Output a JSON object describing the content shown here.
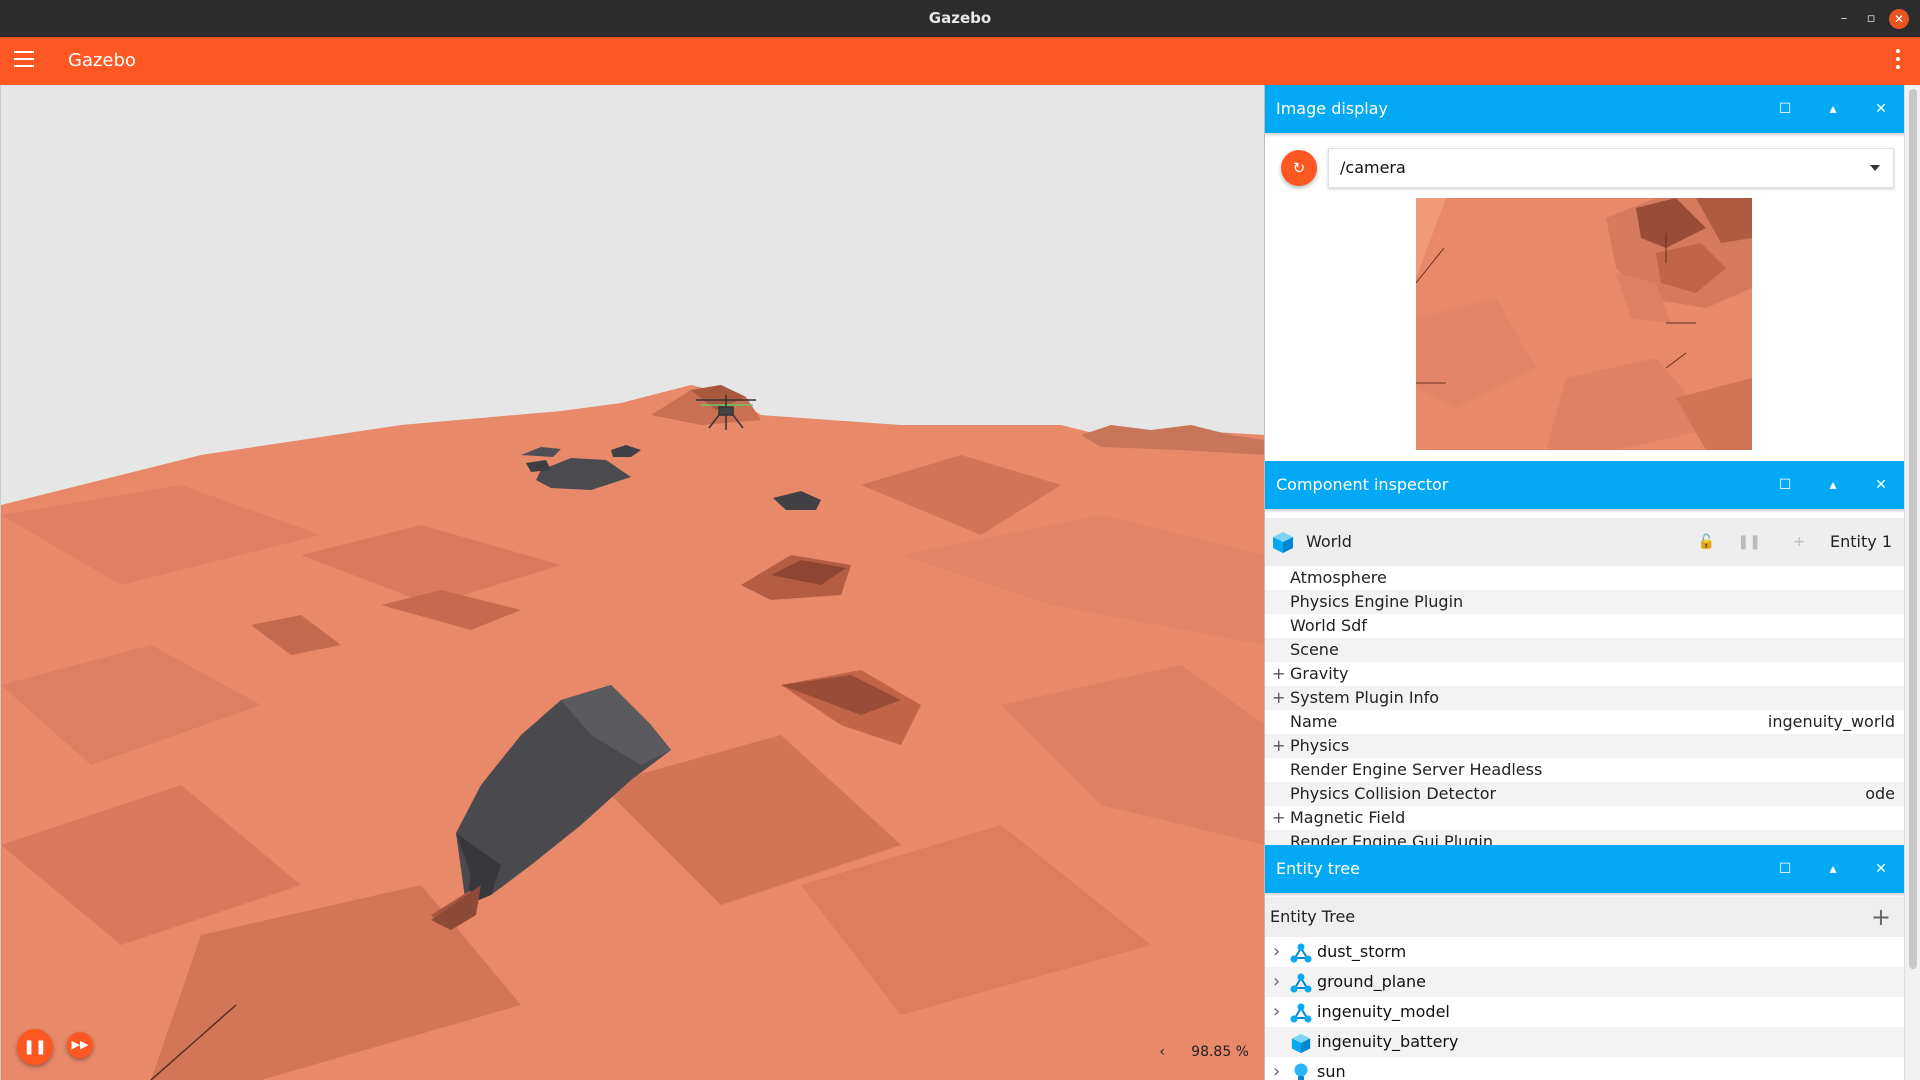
{
  "window": {
    "title": "Gazebo",
    "minimize_glyph": "–",
    "maximize_glyph": "▫",
    "close_glyph": "✕"
  },
  "appbar": {
    "title": "Gazebo",
    "menu_icon": "hamburger-icon",
    "overflow_icon": "kebab-icon"
  },
  "scene": {
    "play_pause_icon": "pause-icon",
    "play_pause_glyph": "❚❚",
    "step_icon": "fast-forward-icon",
    "step_glyph": "▶▶",
    "rtf_arrow": "‹",
    "real_time_factor": "98.85 %"
  },
  "image_display": {
    "title": "Image display",
    "refresh_icon": "refresh-icon",
    "refresh_glyph": "↻",
    "topic": "/camera"
  },
  "component_inspector": {
    "title": "Component inspector",
    "entity_name": "World",
    "entity_id": "Entity 1",
    "lock_glyph": "🔓",
    "pause_glyph": "❚❚",
    "add_glyph": "+",
    "rows": [
      {
        "label": "Atmosphere",
        "expand": "",
        "value": ""
      },
      {
        "label": "Physics Engine Plugin",
        "expand": "",
        "value": ""
      },
      {
        "label": "World Sdf",
        "expand": "",
        "value": ""
      },
      {
        "label": "Scene",
        "expand": "",
        "value": ""
      },
      {
        "label": "Gravity",
        "expand": "+",
        "value": ""
      },
      {
        "label": "System Plugin Info",
        "expand": "+",
        "value": ""
      },
      {
        "label": "Name",
        "expand": "",
        "value": "ingenuity_world"
      },
      {
        "label": "Physics",
        "expand": "+",
        "value": ""
      },
      {
        "label": "Render Engine Server Headless",
        "expand": "",
        "value": ""
      },
      {
        "label": "Physics Collision Detector",
        "expand": "",
        "value": "ode"
      },
      {
        "label": "Magnetic Field",
        "expand": "+",
        "value": ""
      },
      {
        "label": "Render Engine Gui Plugin",
        "expand": "",
        "value": ""
      }
    ]
  },
  "entity_tree": {
    "title": "Entity tree",
    "header": "Entity Tree",
    "add_glyph": "+",
    "items": [
      {
        "name": "dust_storm",
        "icon": "model-icon",
        "expandable": true
      },
      {
        "name": "ground_plane",
        "icon": "model-icon",
        "expandable": true
      },
      {
        "name": "ingenuity_model",
        "icon": "model-icon",
        "expandable": true
      },
      {
        "name": "ingenuity_battery",
        "icon": "cube-icon",
        "expandable": false
      },
      {
        "name": "sun",
        "icon": "light-icon",
        "expandable": true
      }
    ]
  },
  "panel_buttons": {
    "maximize": "☐",
    "collapse": "▴",
    "close": "✕"
  },
  "colors": {
    "primary": "#fe5722",
    "accent": "#03a9f4",
    "terrain": "#e8896a",
    "sky": "#e6e6e6"
  }
}
